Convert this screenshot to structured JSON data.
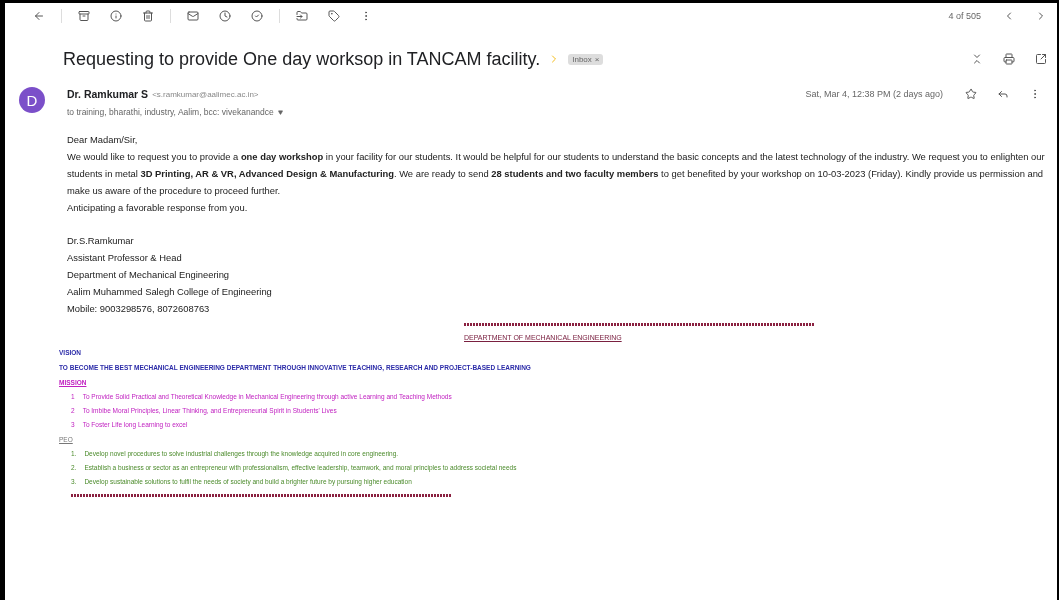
{
  "toolbar": {
    "counter": "4 of 505"
  },
  "subject": {
    "title": "Requesting to provide One day worksop in TANCAM facility.",
    "important": true,
    "label": "Inbox",
    "label_close": "×"
  },
  "message": {
    "avatar_letter": "D",
    "sender": "Dr. Ramkumar S",
    "email": "<s.ramkumar@aalimec.ac.in>",
    "recipients": "to training, bharathi, industry, Aalim, bcc: vivekanandce",
    "date": "Sat, Mar 4, 12:38 PM (2 days ago)",
    "starred": false,
    "greeting": "Dear Madam/Sir,",
    "paragraph": "We would like to request you to provide a **one day workshop** in your facility for our students. It would be helpful for our students to understand the basic concepts and the latest technology of the industry. We request you to enlighten our students in metal **3D Printing, AR & VR, Advanced Design & Manufacturing**. We are ready to send **28 students and two faculty members** to get benefited by your workshop on 10-03-2023 (Friday). Kindly provide us permission and  make us aware of the procedure to proceed further.",
    "closing": "Anticipating a favorable response from you.",
    "signature": [
      "Dr.S.Ramkumar",
      "Assistant Professor & Head",
      "Department of Mechanical Engineering",
      "Aalim Muhammed Salegh College of Engineering",
      "Mobile: 9003298576, 8072608763"
    ]
  },
  "department": {
    "title": "DEPARTMENT OF MECHANICAL ENGINEERING",
    "vision_heading": "VISION",
    "vision": "TO BECOME THE BEST MECHANICAL ENGINEERING DEPARTMENT THROUGH INNOVATIVE TEACHING, RESEARCH AND PROJECT-BASED LEARNING",
    "mission_heading": "MISSION",
    "mission": [
      {
        "number": "1",
        "text": "To Provide Solid Practical and Theoretical Knowledge in Mechanical Engineering through active Learning and Teaching Methods"
      },
      {
        "number": "2",
        "text": "To Imbibe Moral Principles, Linear Thinking, and Entrepreneurial Spirit in Students' Lives"
      },
      {
        "number": "3",
        "text": "To Foster Life long Learning to excel"
      }
    ],
    "peo_heading": "PEO",
    "peo": [
      {
        "number": "1.",
        "text": "Develop novel procedures to solve industrial challenges through the knowledge acquired in core engineering."
      },
      {
        "number": "2.",
        "text": "Establish a business or sector as an entrepreneur with professionalism, effective leadership, teamwork, and moral principles to address societal needs"
      },
      {
        "number": "3.",
        "text": "Develop sustainable solutions to fulfil the needs of society and build a brighter future by pursuing higher education"
      }
    ]
  }
}
